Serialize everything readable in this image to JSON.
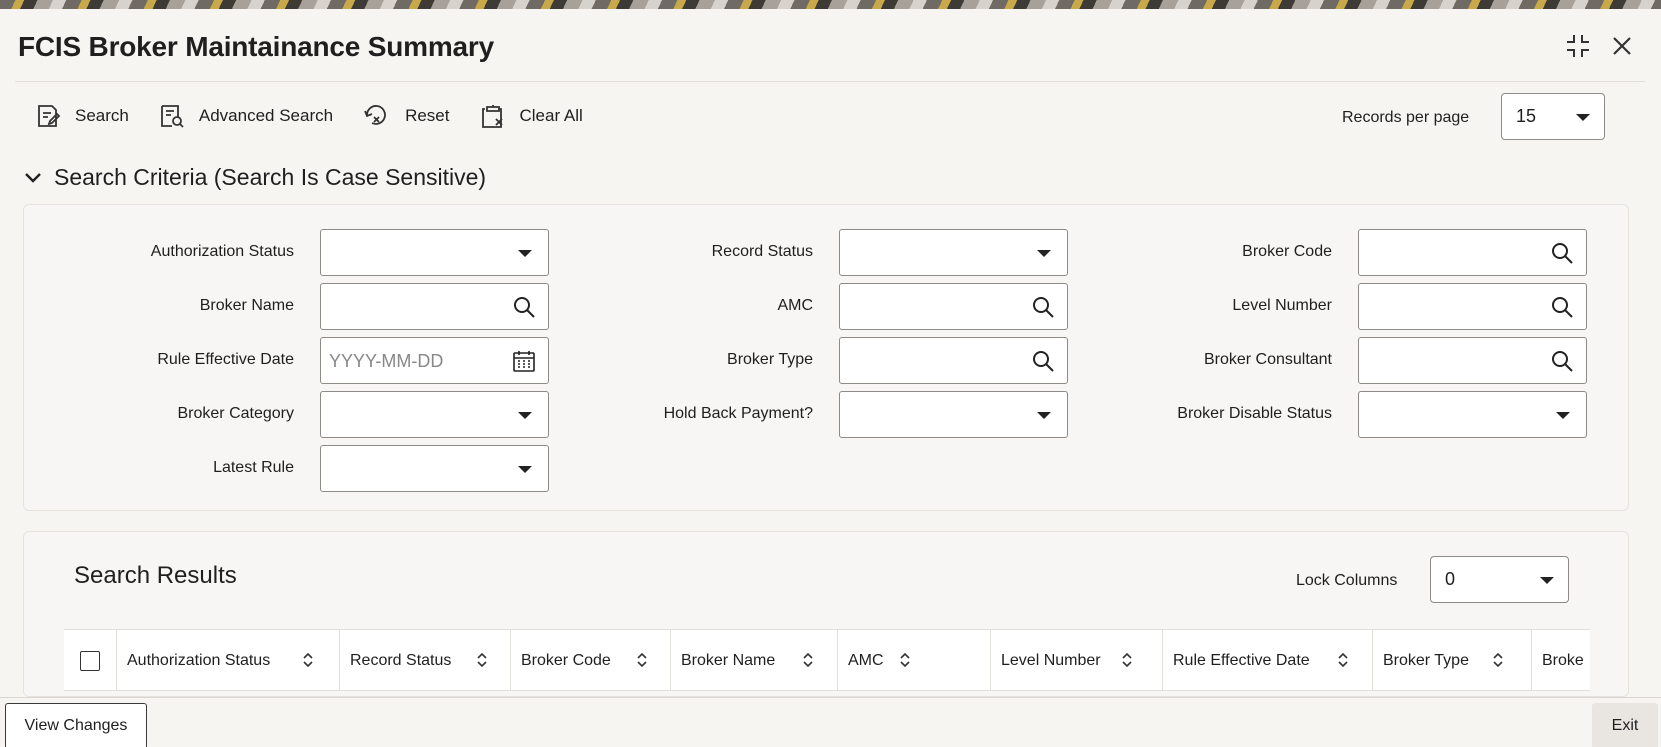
{
  "window": {
    "title": "FCIS Broker Maintainance Summary"
  },
  "toolbar": {
    "search_label": "Search",
    "advanced_search_label": "Advanced Search",
    "reset_label": "Reset",
    "clear_all_label": "Clear All"
  },
  "records_per_page": {
    "label": "Records per page",
    "value": "15"
  },
  "criteria": {
    "heading": "Search Criteria (Search Is Case Sensitive)",
    "fields": {
      "authorization_status": "Authorization Status",
      "record_status": "Record Status",
      "broker_code": "Broker Code",
      "broker_name": "Broker Name",
      "amc": "AMC",
      "level_number": "Level Number",
      "rule_effective_date": "Rule Effective Date",
      "rule_effective_date_placeholder": "YYYY-MM-DD",
      "broker_type": "Broker Type",
      "broker_consultant": "Broker Consultant",
      "broker_category": "Broker Category",
      "hold_back_payment": "Hold Back Payment?",
      "broker_disable_status": "Broker Disable Status",
      "latest_rule": "Latest Rule"
    }
  },
  "results": {
    "title": "Search Results",
    "lock_columns_label": "Lock Columns",
    "lock_columns_value": "0",
    "columns": [
      "Authorization Status",
      "Record Status",
      "Broker Code",
      "Broker Name",
      "AMC",
      "Level Number",
      "Rule Effective Date",
      "Broker Type",
      "Broke"
    ]
  },
  "footer": {
    "view_changes_label": "View Changes",
    "exit_label": "Exit"
  }
}
